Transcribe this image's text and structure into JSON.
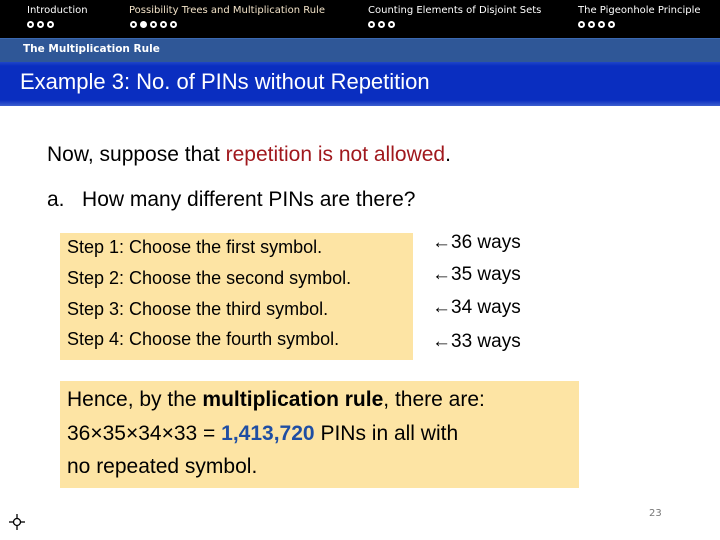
{
  "nav": {
    "sections": [
      {
        "label": "Introduction",
        "dots": 3,
        "active_dot": -1
      },
      {
        "label": "Possibility Trees and Multiplication Rule",
        "dots": 5,
        "active_dot": 1
      },
      {
        "label": "Counting Elements of Disjoint Sets",
        "dots": 3,
        "active_dot": -1
      },
      {
        "label": "The Pigeonhole Principle",
        "dots": 4,
        "active_dot": -1
      }
    ],
    "subsection": "The Multiplication Rule"
  },
  "slide": {
    "title": "Example 3: No. of PINs without Repetition",
    "intro_prefix": "Now, suppose that ",
    "intro_highlight": "repetition is not allowed",
    "intro_suffix": ".",
    "question_marker": "a.",
    "question": "How many different PINs are there?",
    "steps": [
      {
        "text": "Step 1: Choose the first symbol.",
        "ways": "36 ways"
      },
      {
        "text": "Step 2: Choose the second symbol.",
        "ways": "35 ways"
      },
      {
        "text": "Step 3: Choose the third symbol.",
        "ways": "34 ways"
      },
      {
        "text": "Step 4: Choose the fourth symbol.",
        "ways": "33 ways"
      }
    ],
    "arrow_glyph": "←",
    "summary": {
      "l1_prefix": "Hence, by the ",
      "l1_bold": "multiplication rule",
      "l1_suffix": ", there are:",
      "l2_expr": "36×35×34×33 = ",
      "l2_result": "1,413,720",
      "l2_suffix": " PINs in all with",
      "l3": "no repeated symbol."
    },
    "page_number": "23"
  },
  "colors": {
    "nav_bg": "#000000",
    "subbar_bg": "#2f5797",
    "title_bg": "#0a2ec0",
    "highlight_box": "#fde4a4",
    "red_text": "#a0181d",
    "blue_text": "#1f4ea3"
  }
}
